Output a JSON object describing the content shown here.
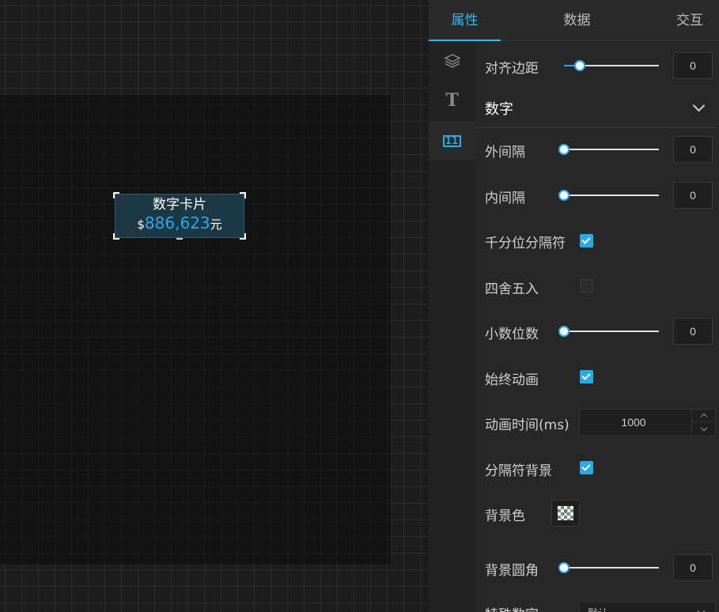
{
  "canvas": {
    "widget": {
      "title": "数字卡片",
      "prefix": "$",
      "value": "886,623",
      "suffix": "元"
    }
  },
  "panel": {
    "tabs": [
      "属性",
      "数据",
      "交互"
    ],
    "active_tab": "属性",
    "sidebar_icons": [
      "layers-icon",
      "text-icon",
      "number-icon"
    ],
    "align_margin": {
      "label": "对齐边距",
      "value": "0"
    },
    "section": {
      "title": "数字",
      "expanded": true
    },
    "outer_margin": {
      "label": "外间隔",
      "value": "0"
    },
    "inner_padding": {
      "label": "内间隔",
      "value": "0"
    },
    "thousands_separator": {
      "label": "千分位分隔符",
      "checked": true
    },
    "rounding": {
      "label": "四舍五入",
      "checked": false
    },
    "decimal_places": {
      "label": "小数位数",
      "value": "0"
    },
    "always_animate": {
      "label": "始终动画",
      "checked": true
    },
    "animation_duration": {
      "label": "动画时间(ms)",
      "value": "1000"
    },
    "separator_background": {
      "label": "分隔符背景",
      "checked": true
    },
    "background_color": {
      "label": "背景色"
    },
    "background_radius": {
      "label": "背景圆角",
      "value": "0"
    },
    "special_number": {
      "label": "特殊数字",
      "value": "默认"
    }
  },
  "colors": {
    "accent": "#3db6f2",
    "widget_bg": "#1c3844",
    "value_color": "#29a8f0",
    "panel_bg": "#272727"
  }
}
